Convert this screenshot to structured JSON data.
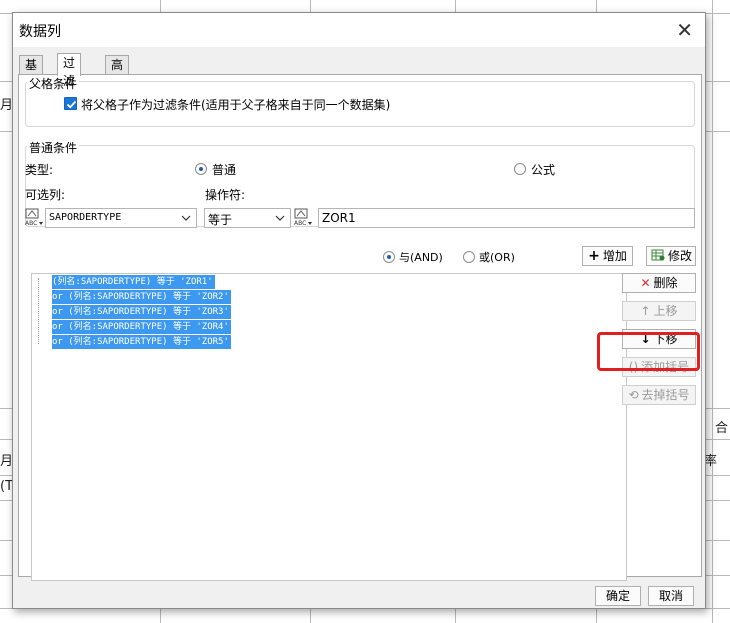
{
  "background": {
    "cells": [
      "月",
      "月",
      "(T",
      "合",
      "率"
    ]
  },
  "dialog": {
    "title": "数据列",
    "close_glyph": "✕",
    "tabs": [
      "基本",
      "过滤",
      "高级"
    ],
    "active_tab": "过滤",
    "parent": {
      "legend": "父格条件",
      "checkbox_label": "将父格子作为过滤条件(适用于父子格来自于同一个数据集)",
      "checked": true
    },
    "normal": {
      "legend": "普通条件",
      "type_label": "类型:",
      "radio_normal": "普通",
      "radio_formula": "公式",
      "column_label": "可选列:",
      "operator_label": "操作符:",
      "column_value": "SAPORDERTYPE",
      "operator_value": "等于",
      "value_text": "ZOR1",
      "and_label": "与(AND)",
      "or_label": "或(OR)",
      "add_button": "增加",
      "edit_button": "修改"
    },
    "conditions": [
      "(列名:SAPORDERTYPE) 等于 'ZOR1'",
      "or  (列名:SAPORDERTYPE) 等于 'ZOR2'",
      "or  (列名:SAPORDERTYPE) 等于 'ZOR3'",
      "or  (列名:SAPORDERTYPE) 等于 'ZOR4'",
      "or  (列名:SAPORDERTYPE) 等于 'ZOR5'"
    ],
    "side_buttons": {
      "delete": "删除",
      "up": "上移",
      "down": "下移",
      "add_paren": "添加括号",
      "remove_paren": "去掉括号"
    },
    "ok": "确定",
    "cancel": "取消"
  },
  "colors": {
    "selection": "#3d98f0",
    "highlight": "#e02020",
    "checkbox": "#1976d2"
  }
}
